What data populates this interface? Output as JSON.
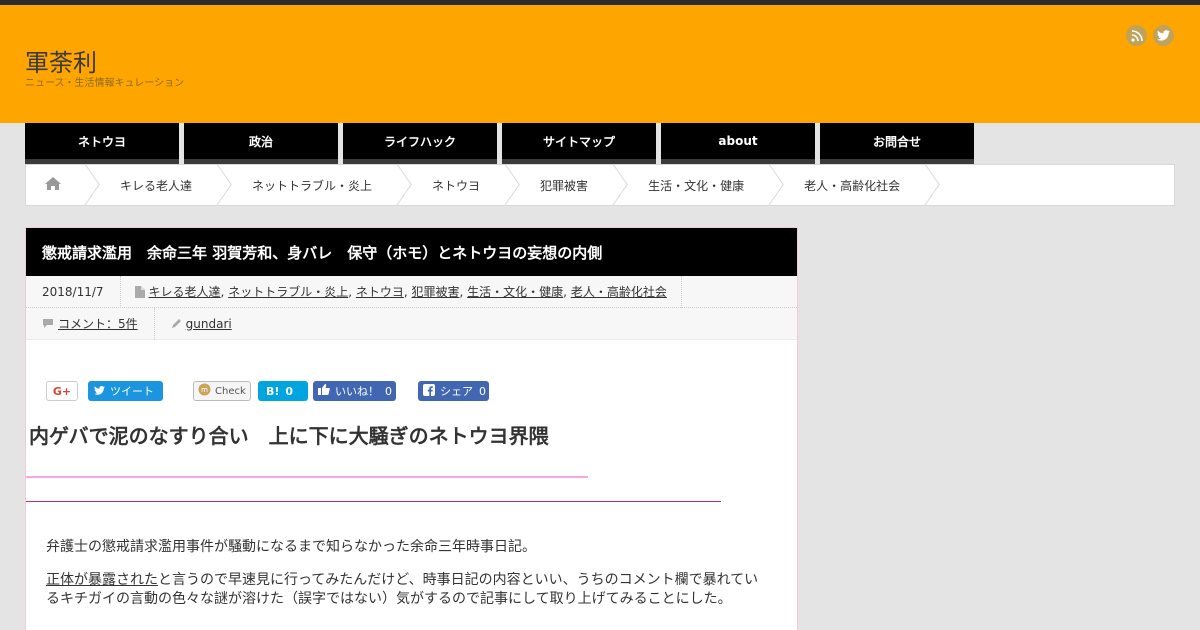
{
  "site": {
    "title": "軍荼利",
    "description": "ニュース・生活情報キュレーション"
  },
  "social": [
    {
      "icon": "rss-icon"
    },
    {
      "icon": "twitter-icon"
    }
  ],
  "nav": [
    "ネトウヨ",
    "政治",
    "ライフハック",
    "サイトマップ",
    "about",
    "お問合せ"
  ],
  "breadcrumbs": {
    "home_icon": "home-icon",
    "items": [
      "キレる老人達",
      "ネットトラブル・炎上",
      "ネトウヨ",
      "犯罪被害",
      "生活・文化・健康",
      "老人・高齢化社会"
    ]
  },
  "article": {
    "title": "懲戒請求濫用　余命三年 羽賀芳和、身バレ　保守（ホモ）とネトウヨの妄想の内側",
    "date": "2018/11/7",
    "categories": [
      "キレる老人達",
      "ネットトラブル・炎上",
      "ネトウヨ",
      "犯罪被害",
      "生活・文化・健康",
      "老人・高齢化社会"
    ],
    "comments": "コメント：5件",
    "author": "gundari",
    "heading": "内ゲバで泥のなすり合い　上に下に大騒ぎのネトウヨ界隈",
    "p1": "弁護士の懲戒請求濫用事件が騒動になるまで知らなかった余命三年時事日記。",
    "p2_link": "正体が暴露された",
    "p2_text": "と言うので早速見に行ってみたんだけど、時事日記の内容といい、うちのコメント欄で暴れているキチガイの言動の色々な謎が溶けた（誤字ではない）気がするので記事にして取り上げてみることにした。"
  },
  "share": {
    "gplus": "G+",
    "tweet": "ツイート",
    "check": "Check",
    "hatena": "B!",
    "hatena_count": "0",
    "like": "いいね！",
    "like_count": "0",
    "fb": "シェア",
    "fb_count": "0"
  },
  "colors": {
    "header_bg": "#ffa500",
    "nav_bg": "#000000",
    "twitter": "#1b95e0",
    "facebook": "#4267b2",
    "hatena": "#00a4de"
  }
}
